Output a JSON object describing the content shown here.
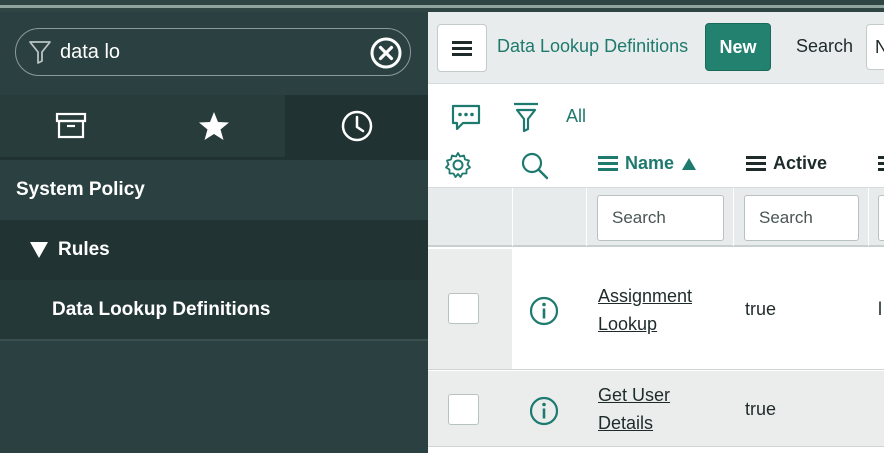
{
  "nav": {
    "filter": {
      "value": "data lo"
    },
    "tabs": [
      {
        "icon": "archive-icon"
      },
      {
        "icon": "star-icon"
      },
      {
        "icon": "clock-icon"
      }
    ],
    "section": "System Policy",
    "group": "Rules",
    "item": "Data Lookup Definitions"
  },
  "header": {
    "title": "Data Lookup Definitions",
    "new_label": "New",
    "search_label": "Search",
    "search_select_value": "N"
  },
  "toolbar": {
    "all_label": "All"
  },
  "columns": {
    "name": "Name",
    "active": "Active"
  },
  "filters": {
    "name_placeholder": "Search",
    "active_placeholder": "Search"
  },
  "rows": [
    {
      "name_line1": "Assignment",
      "name_line2": "Lookup",
      "active": "true",
      "next": "l"
    },
    {
      "name_line1": "Get User",
      "name_line2": "Details",
      "active": "true",
      "next": ""
    }
  ],
  "colors": {
    "accent": "#1e7a6e",
    "nav_bg": "#2b4040",
    "new_button": "#22826f"
  }
}
